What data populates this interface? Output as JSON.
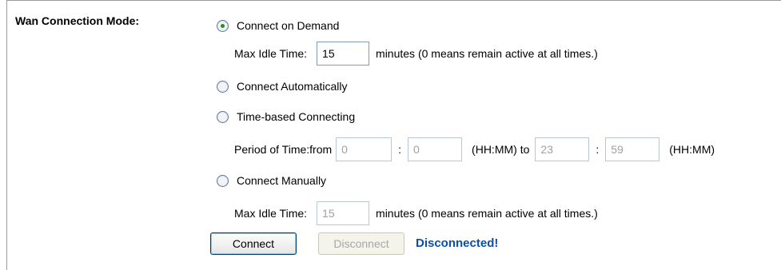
{
  "wan_mode": {
    "label": "Wan Connection Mode:",
    "options": {
      "on_demand": "Connect on Demand",
      "automatic": "Connect Automatically",
      "time_based": "Time-based Connecting",
      "manual": "Connect Manually"
    },
    "selected": "on_demand"
  },
  "on_demand": {
    "max_idle_label": "Max Idle Time:",
    "max_idle_value": "15",
    "note": "minutes (0 means remain active at all times.)"
  },
  "time_based": {
    "period_label": "Period of Time:from",
    "from_hh": "0",
    "from_mm": "0",
    "colon": ":",
    "to_label": "(HH:MM) to",
    "to_hh": "23",
    "to_mm": "59",
    "end_label": "(HH:MM)"
  },
  "manual": {
    "max_idle_label": "Max Idle Time:",
    "max_idle_value": "15",
    "note": "minutes (0 means remain active at all times.)"
  },
  "actions": {
    "connect_label": "Connect",
    "disconnect_label": "Disconnect",
    "status_text": "Disconnected!"
  },
  "colors": {
    "status": "#0d4ea6",
    "radio_dot": "#2a8c23",
    "input_border": "#7f9db9"
  }
}
